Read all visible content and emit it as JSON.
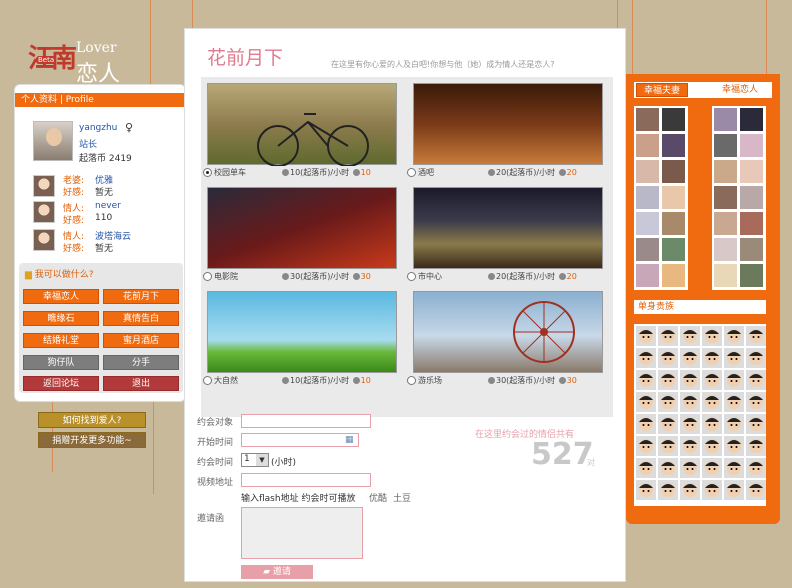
{
  "logo": {
    "cn": "江南",
    "beta": "Beta",
    "en": "Lover",
    "en_cn": "恋人"
  },
  "profile": {
    "header": "个人资料 | Profile",
    "username": "yangzhu",
    "role": "站长",
    "coins": "起落币 2419",
    "relations": [
      {
        "label": "老婆:",
        "name": "优雅",
        "affinity_label": "好感:",
        "affinity": "暂无"
      },
      {
        "label": "情人:",
        "name": "never",
        "affinity_label": "好感:",
        "affinity": "110"
      },
      {
        "label": "情人:",
        "name": "波塔海云",
        "affinity_label": "好感:",
        "affinity": "暂无"
      }
    ]
  },
  "actions": {
    "title": "我可以做什么?",
    "buttons": [
      "幸福恋人",
      "花前月下",
      "瞧缘石",
      "真情告白",
      "结婚礼堂",
      "蜜月酒店",
      "狗仔队",
      "分手",
      "返回论坛",
      "退出"
    ],
    "help": "如何找到爱人?",
    "donate": "捐赠开发更多功能~"
  },
  "center": {
    "title": "花前月下",
    "subtitle": "在这里有你心爱的人及白吧!你想与他（她）成为情人还是恋人?",
    "scenes": [
      {
        "name": "校园单车",
        "price": "10(起落币)/小时",
        "count": "10",
        "selected": true
      },
      {
        "name": "酒吧",
        "price": "20(起落币)/小时",
        "count": "20",
        "selected": false
      },
      {
        "name": "电影院",
        "price": "30(起落币)/小时",
        "count": "30",
        "selected": false
      },
      {
        "name": "市中心",
        "price": "20(起落币)/小时",
        "count": "20",
        "selected": false
      },
      {
        "name": "大自然",
        "price": "10(起落币)/小时",
        "count": "10",
        "selected": false
      },
      {
        "name": "游乐场",
        "price": "30(起落币)/小时",
        "count": "30",
        "selected": false
      }
    ],
    "form": {
      "target_label": "约会对象",
      "start_label": "开始时间",
      "duration_label": "约会时间",
      "duration_value": "1",
      "duration_unit": "(小时)",
      "video_label": "视频地址",
      "video_hint": "输入flash地址 约会时可播放",
      "video_links": [
        "优酷",
        "土豆"
      ],
      "invite_label": "邀请函",
      "submit": "邀请"
    },
    "stats": {
      "label": "在这里约会过的情侣共有",
      "count": "527",
      "unit": "对"
    }
  },
  "right": {
    "tabs": [
      "幸福夫妻",
      "幸福恋人"
    ],
    "single_title": "单身贵族"
  }
}
